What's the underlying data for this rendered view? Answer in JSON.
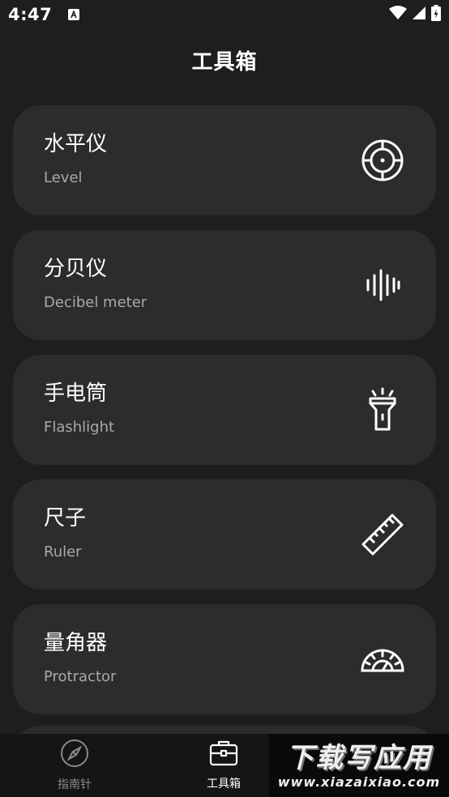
{
  "status_bar": {
    "time": "4:47",
    "icons": [
      "app-notification-icon",
      "wifi-icon",
      "signal-icon",
      "battery-icon"
    ]
  },
  "header": {
    "title": "工具箱"
  },
  "tools": [
    {
      "title": "水平仪",
      "subtitle": "Level",
      "icon": "level-target-icon"
    },
    {
      "title": "分贝仪",
      "subtitle": "Decibel meter",
      "icon": "sound-wave-icon"
    },
    {
      "title": "手电筒",
      "subtitle": "Flashlight",
      "icon": "flashlight-icon"
    },
    {
      "title": "尺子",
      "subtitle": "Ruler",
      "icon": "ruler-icon"
    },
    {
      "title": "量角器",
      "subtitle": "Protractor",
      "icon": "protractor-icon"
    }
  ],
  "bottom_nav": {
    "items": [
      {
        "label": "指南针",
        "icon": "compass-icon",
        "active": false
      },
      {
        "label": "工具箱",
        "icon": "toolbox-icon",
        "active": true
      }
    ]
  },
  "watermark": {
    "title": "下载写应用",
    "url": "www.xiazaixiao.com"
  },
  "colors": {
    "background": "#1e1e1e",
    "card": "#2c2c2c",
    "nav_background": "#151515",
    "subtitle": "#a9a9a9",
    "nav_inactive": "#8a8a8a"
  }
}
